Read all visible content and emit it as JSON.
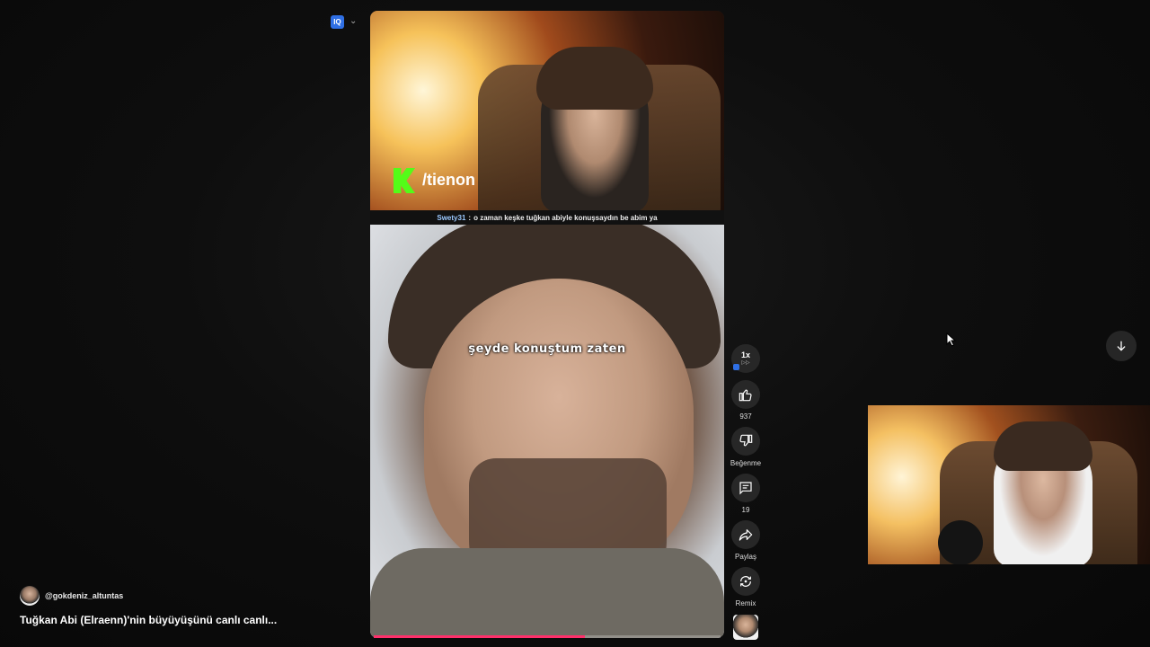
{
  "extension": {
    "badge": "IQ",
    "chevron": "⌄"
  },
  "video": {
    "overlay_handle": "/tienon",
    "chat": {
      "user": "Swety31",
      "separator": ":",
      "message": "o zaman keşke tuğkan abiyle konuşsaydın be abim ya"
    },
    "caption": "şeyde konuştum zaten",
    "progress_percent": 61,
    "progress_color": "#ff2f6b"
  },
  "actions": {
    "speed": "1x",
    "speed_sub": "▷▷",
    "like_count": "937",
    "dislike_label": "Beğenme",
    "comment_count": "19",
    "share_label": "Paylaş",
    "remix_label": "Remix"
  },
  "channel": {
    "handle": "@gokdeniz_altuntas",
    "title": "Tuğkan Abi (Elraenn)'nin büyüyüşünü canlı canlı..."
  },
  "icons": {
    "like": "thumbs-up-icon",
    "dislike": "thumbs-down-icon",
    "comment": "comment-icon",
    "share": "share-icon",
    "remix": "remix-icon",
    "next": "arrow-down-icon"
  }
}
